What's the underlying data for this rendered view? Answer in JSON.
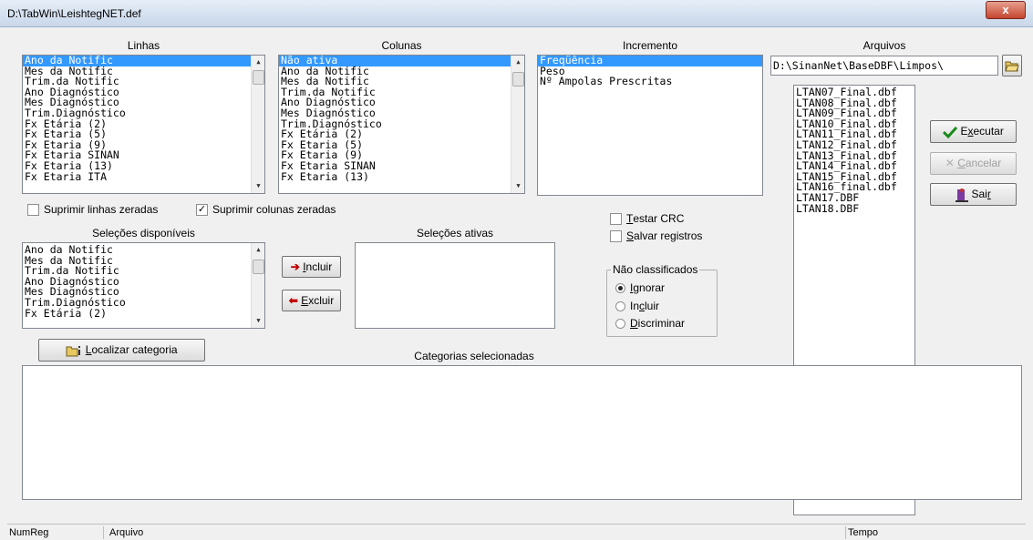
{
  "window": {
    "title": "D:\\TabWin\\LeishtegNET.def",
    "close_glyph": "x"
  },
  "lists": {
    "linhas": {
      "label": "Linhas",
      "items": [
        "Ano da Notific",
        "Mes da Notific",
        "Trim.da Notific",
        "Ano Diagnóstico",
        "Mes Diagnóstico",
        "Trim.Diagnóstico",
        "Fx Etária (2)",
        "Fx Etaria (5)",
        "Fx Etaria (9)",
        "Fx Etaria SINAN",
        "Fx Etaria (13)",
        "Fx Etaria ITA"
      ],
      "selected": 0
    },
    "colunas": {
      "label": "Colunas",
      "items": [
        "Não ativa",
        "Ano da Notific",
        "Mes da Notific",
        "Trim.da Notific",
        "Ano Diagnóstico",
        "Mes Diagnóstico",
        "Trim.Diagnóstico",
        "Fx Etária (2)",
        "Fx Etaria (5)",
        "Fx Etaria (9)",
        "Fx Etaria SINAN",
        "Fx Etaria (13)"
      ],
      "selected": 0
    },
    "incremento": {
      "label": "Incremento",
      "items": [
        "Freqüência",
        "Peso",
        "Nº Ampolas Prescritas"
      ],
      "selected": 0
    },
    "selecoes_disponiveis": {
      "label": "Seleções disponíveis",
      "items": [
        "Ano da Notific",
        "Mes da Notific",
        "Trim.da Notific",
        "Ano Diagnóstico",
        "Mes Diagnóstico",
        "Trim.Diagnóstico",
        "Fx Etária (2)"
      ]
    },
    "selecoes_ativas": {
      "label": "Seleções ativas",
      "items": []
    },
    "arquivos": {
      "label": "Arquivos",
      "path": "D:\\SinanNet\\BaseDBF\\Limpos\\",
      "items": [
        "LTAN07_Final.dbf",
        "LTAN08_Final.dbf",
        "LTAN09_Final.dbf",
        "LTAN10_Final.dbf",
        "LTAN11_Final.dbf",
        "LTAN12_Final.dbf",
        "LTAN13_Final.dbf",
        "LTAN14_Final.dbf",
        "LTAN15_Final.dbf",
        "LTAN16_final.dbf",
        "LTAN17.DBF",
        "LTAN18.DBF"
      ]
    }
  },
  "options": {
    "suprimir_linhas": {
      "label": "Suprimir linhas zeradas",
      "checked": false
    },
    "suprimir_colunas": {
      "label": "Suprimir colunas zeradas",
      "checked": true
    },
    "testar_crc": {
      "label_prefix": "",
      "label_u": "T",
      "label_rest": "estar CRC",
      "checked": false
    },
    "salvar_registros": {
      "label_u": "S",
      "label_rest": "alvar registros",
      "checked": false
    }
  },
  "nao_classificados": {
    "title": "Não classificados",
    "options": [
      {
        "u": "I",
        "rest": "gnorar",
        "checked": true
      },
      {
        "pre": "In",
        "u": "c",
        "rest": "luir",
        "checked": false
      },
      {
        "u": "D",
        "rest": "iscriminar",
        "checked": false
      }
    ]
  },
  "buttons": {
    "incluir": {
      "u": "I",
      "rest": "ncluir"
    },
    "excluir": {
      "u": "E",
      "rest": "xcluir"
    },
    "executar": {
      "u": "x",
      "pre": "E",
      "rest": "ecutar"
    },
    "cancelar": {
      "u": "C",
      "rest": "ancelar"
    },
    "sair": {
      "pre": "Sai",
      "u": "r",
      "rest": ""
    },
    "localizar": {
      "u": "L",
      "rest": "ocalizar categoria"
    }
  },
  "categorias": {
    "label": "Categorias selecionadas"
  },
  "status": {
    "numreg": "NumReg",
    "arquivo": "Arquivo",
    "tempo": "Tempo"
  }
}
